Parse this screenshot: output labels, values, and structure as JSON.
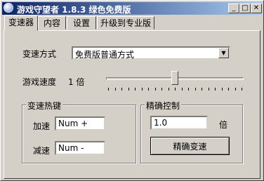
{
  "window": {
    "title": "游戏守望者 1.8.3 绿色免费版",
    "min_glyph": "_",
    "max_glyph": "□",
    "close_glyph": "✕"
  },
  "tabs": [
    {
      "label": "变速器",
      "active": true
    },
    {
      "label": "内容",
      "active": false
    },
    {
      "label": "设置",
      "active": false
    },
    {
      "label": "升级到专业版",
      "active": false
    }
  ],
  "speed": {
    "mode_label": "变速方式",
    "mode_value": "免费版普通方式",
    "speed_label": "游戏速度",
    "speed_value": "1 倍",
    "slider_position": 0.5
  },
  "hotkeys": {
    "group_title": "变速热键",
    "accelerate_label": "加速",
    "accelerate_value": "Num +",
    "decelerate_label": "减速",
    "decelerate_value": "Num -"
  },
  "precise": {
    "group_title": "精确控制",
    "value": "1.0",
    "unit": "倍",
    "button_label": "精确变速"
  },
  "colors": {
    "title_gradient_start": "#0a246a",
    "title_gradient_end": "#a6caf0",
    "face": "#d4d0c8"
  }
}
